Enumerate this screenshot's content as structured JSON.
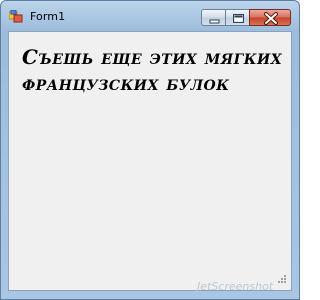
{
  "window": {
    "title": "Form1",
    "icons": {
      "app": "form-app-icon",
      "minimize": "minimize-icon",
      "maximize": "maximize-icon",
      "close": "close-icon"
    }
  },
  "label": {
    "text": "Съешь еще этих мягких французских булок"
  },
  "watermark": {
    "text": "JetScreenshot"
  },
  "colors": {
    "frame": "#a9c6e4",
    "client_background": "#f0f0f0",
    "close_button": "#c7422b"
  }
}
